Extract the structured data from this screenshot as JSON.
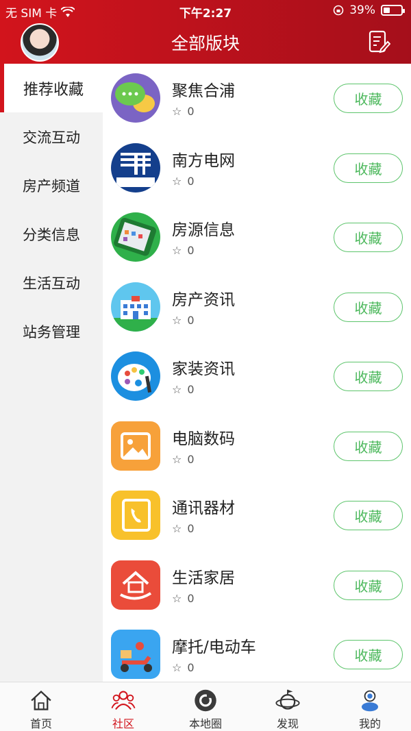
{
  "status": {
    "carrier": "无 SIM 卡",
    "time": "下午2:27",
    "battery": "39%",
    "battery_level": 0.39
  },
  "header": {
    "title": "全部版块"
  },
  "sidebar": {
    "items": [
      {
        "label": "推荐收藏"
      },
      {
        "label": "交流互动"
      },
      {
        "label": "房产频道"
      },
      {
        "label": "分类信息"
      },
      {
        "label": "生活互动"
      },
      {
        "label": "站务管理"
      }
    ]
  },
  "forums": [
    {
      "name": "聚焦合浦",
      "count": "0",
      "button": "收藏",
      "icon": "chat-bubble-icon"
    },
    {
      "name": "南方电网",
      "count": "0",
      "button": "收藏",
      "icon": "power-grid-logo-icon"
    },
    {
      "name": "房源信息",
      "count": "0",
      "button": "收藏",
      "icon": "phone-apps-icon"
    },
    {
      "name": "房产资讯",
      "count": "0",
      "button": "收藏",
      "icon": "building-icon"
    },
    {
      "name": "家装资讯",
      "count": "0",
      "button": "收藏",
      "icon": "palette-icon"
    },
    {
      "name": "电脑数码",
      "count": "0",
      "button": "收藏",
      "icon": "picture-icon"
    },
    {
      "name": "通讯器材",
      "count": "0",
      "button": "收藏",
      "icon": "phone-book-icon"
    },
    {
      "name": "生活家居",
      "count": "0",
      "button": "收藏",
      "icon": "house-hand-icon"
    },
    {
      "name": "摩托/电动车",
      "count": "0",
      "button": "收藏",
      "icon": "scooter-icon"
    }
  ],
  "tabbar": {
    "items": [
      {
        "label": "首页"
      },
      {
        "label": "社区"
      },
      {
        "label": "本地圈"
      },
      {
        "label": "发现"
      },
      {
        "label": "我的"
      }
    ]
  },
  "colors": {
    "brand": "#d2141c",
    "accent_green": "#4cb85c"
  }
}
